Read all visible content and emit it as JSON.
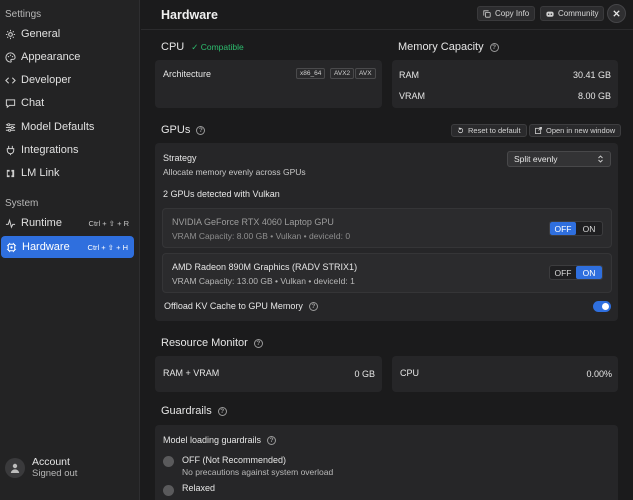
{
  "sidebar": {
    "settings_heading": "Settings",
    "items": [
      {
        "label": "General",
        "icon": "gear-icon"
      },
      {
        "label": "Appearance",
        "icon": "palette-icon"
      },
      {
        "label": "Developer",
        "icon": "code-icon"
      },
      {
        "label": "Chat",
        "icon": "chat-icon"
      },
      {
        "label": "Model Defaults",
        "icon": "sliders-icon"
      },
      {
        "label": "Integrations",
        "icon": "plug-icon"
      },
      {
        "label": "LM Link",
        "icon": "link-icon"
      }
    ],
    "system_heading": "System",
    "system_items": [
      {
        "label": "Runtime",
        "shortcut": "Ctrl + ⇧ + R",
        "icon": "pulse-icon"
      },
      {
        "label": "Hardware",
        "shortcut": "Ctrl + ⇧ + H",
        "icon": "chip-icon",
        "active": true
      }
    ],
    "account": {
      "name": "Account",
      "status": "Signed out"
    }
  },
  "header": {
    "title": "Hardware",
    "copy_info": "Copy Info",
    "community": "Community"
  },
  "cpu": {
    "title": "CPU",
    "status": "✓ Compatible",
    "arch_label": "Architecture",
    "chips": [
      "x86_64",
      "AVX2",
      "AVX"
    ]
  },
  "memory": {
    "title": "Memory Capacity",
    "ram_label": "RAM",
    "ram_value": "30.41 GB",
    "vram_label": "VRAM",
    "vram_value": "8.00 GB"
  },
  "gpus": {
    "title": "GPUs",
    "reset": "Reset to default",
    "open_window": "Open in new window",
    "strategy_label": "Strategy",
    "strategy_desc": "Allocate memory evenly across GPUs",
    "strategy_value": "Split evenly",
    "detected": "2 GPUs detected with Vulkan",
    "devices": [
      {
        "name": "NVIDIA GeForce RTX 4060 Laptop GPU",
        "details": "VRAM Capacity: 8.00 GB • Vulkan • deviceId: 0",
        "off": "OFF",
        "on": "ON",
        "state": "off"
      },
      {
        "name": "AMD Radeon 890M Graphics (RADV STRIX1)",
        "details": "VRAM Capacity: 13.00 GB • Vulkan • deviceId: 1",
        "off": "OFF",
        "on": "ON",
        "state": "on"
      }
    ],
    "offload_label": "Offload KV Cache to GPU Memory",
    "offload_enabled": true
  },
  "resource_monitor": {
    "title": "Resource Monitor",
    "ram_vram_label": "RAM + VRAM",
    "ram_vram_value": "0 GB",
    "cpu_label": "CPU",
    "cpu_value": "0.00%"
  },
  "guardrails": {
    "title": "Guardrails",
    "model_loading_label": "Model loading guardrails",
    "options": [
      {
        "label": "OFF (Not Recommended)",
        "desc": "No precautions against system overload"
      },
      {
        "label": "Relaxed",
        "desc": ""
      }
    ]
  },
  "colors": {
    "accent": "#2f6fde",
    "compatible": "#2dbd6e",
    "background": "#1b1b1c",
    "card": "#262628"
  }
}
